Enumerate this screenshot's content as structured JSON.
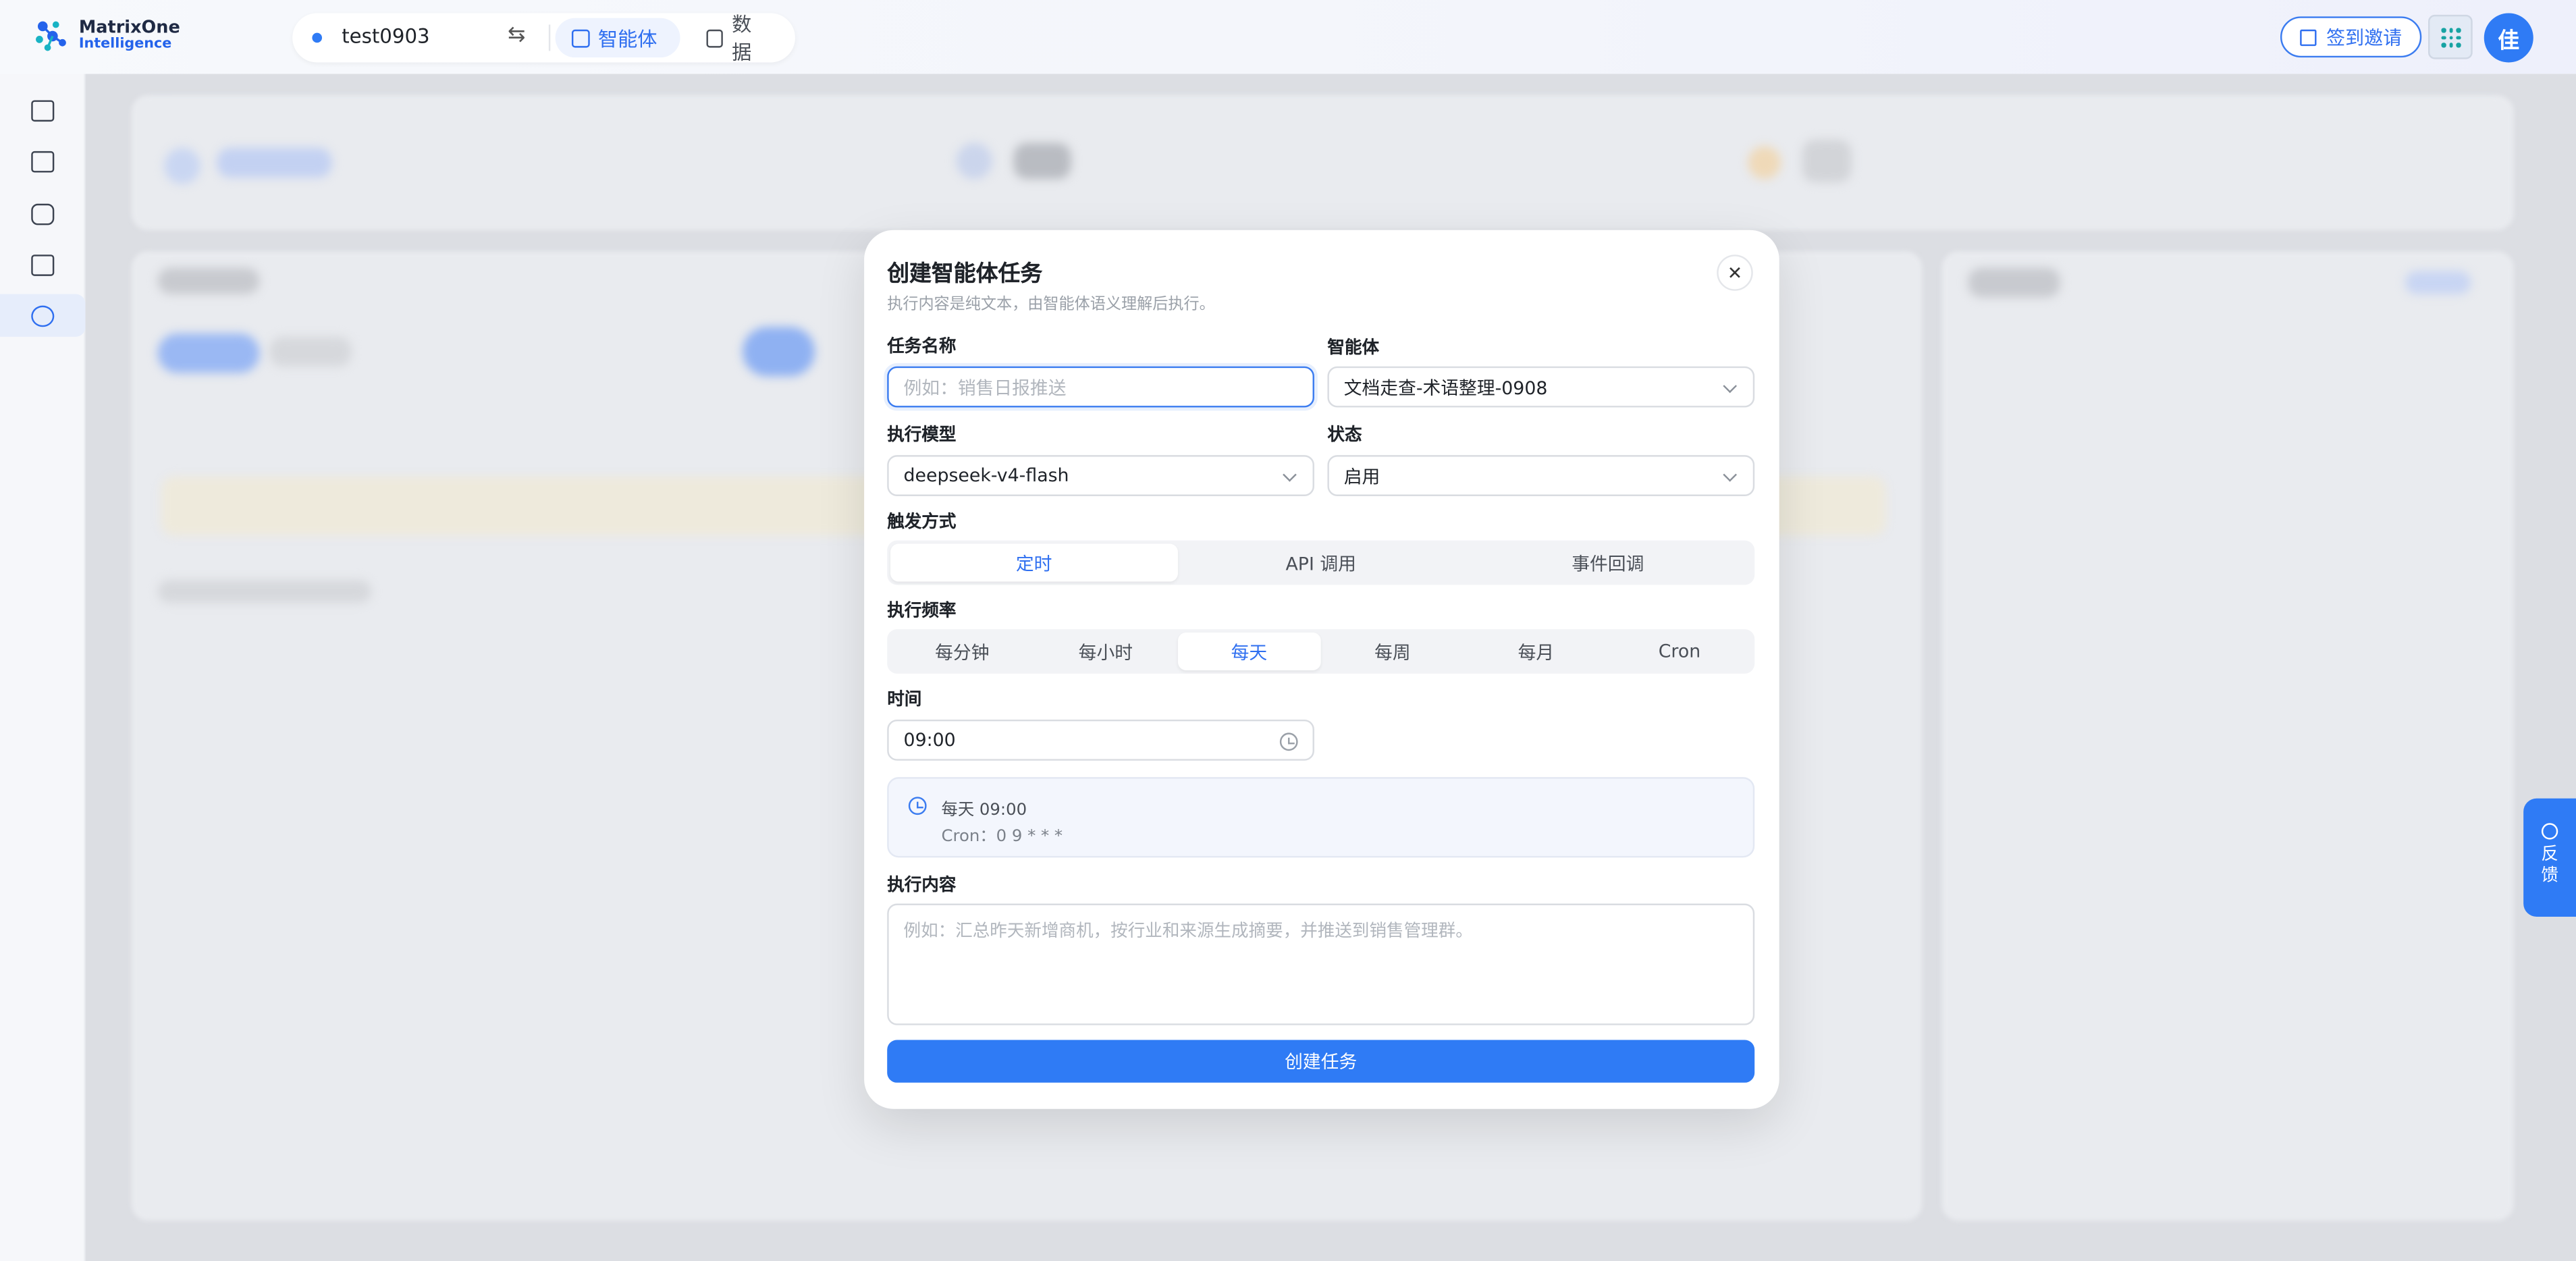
{
  "app": {
    "logo_line1": "MatrixOne",
    "logo_line2": "Intelligence"
  },
  "header": {
    "workspace_name": "test0903",
    "tabs": [
      {
        "label": "智能体",
        "active": true
      },
      {
        "label": "数据",
        "active": false
      }
    ],
    "invite_label": "签到邀请",
    "avatar_text": "佳"
  },
  "rail": {
    "items": [
      {
        "name": "toggle-sidebar"
      },
      {
        "name": "new-chat"
      },
      {
        "name": "agents"
      },
      {
        "name": "apps"
      },
      {
        "name": "scheduled-tasks",
        "active": true
      }
    ]
  },
  "modal": {
    "title": "创建智能体任务",
    "subtitle": "执行内容是纯文本，由智能体语义理解后执行。",
    "task_name_label": "任务名称",
    "task_name_placeholder": "例如：销售日报推送",
    "agent_label": "智能体",
    "agent_value": "文档走查-术语整理-0908",
    "model_label": "执行模型",
    "model_value": "deepseek-v4-flash",
    "status_label": "状态",
    "status_value": "启用",
    "trigger_label": "触发方式",
    "trigger_options": [
      "定时",
      "API 调用",
      "事件回调"
    ],
    "trigger_selected": "定时",
    "frequency_label": "执行频率",
    "frequency_options": [
      "每分钟",
      "每小时",
      "每天",
      "每周",
      "每月",
      "Cron"
    ],
    "frequency_selected": "每天",
    "time_label": "时间",
    "time_value": "09:00",
    "summary_line1": "每天 09:00",
    "summary_line2": "Cron：0 9 * * *",
    "content_label": "执行内容",
    "content_placeholder": "例如：汇总昨天新增商机，按行业和来源生成摘要，并推送到销售管理群。",
    "submit_label": "创建任务"
  },
  "feedback": {
    "label_line1": "反",
    "label_line2": "馈"
  },
  "colors": {
    "primary": "#2f7bf5",
    "accent_text": "#2f6ff0",
    "overlay_bg": "#dcdee3"
  }
}
